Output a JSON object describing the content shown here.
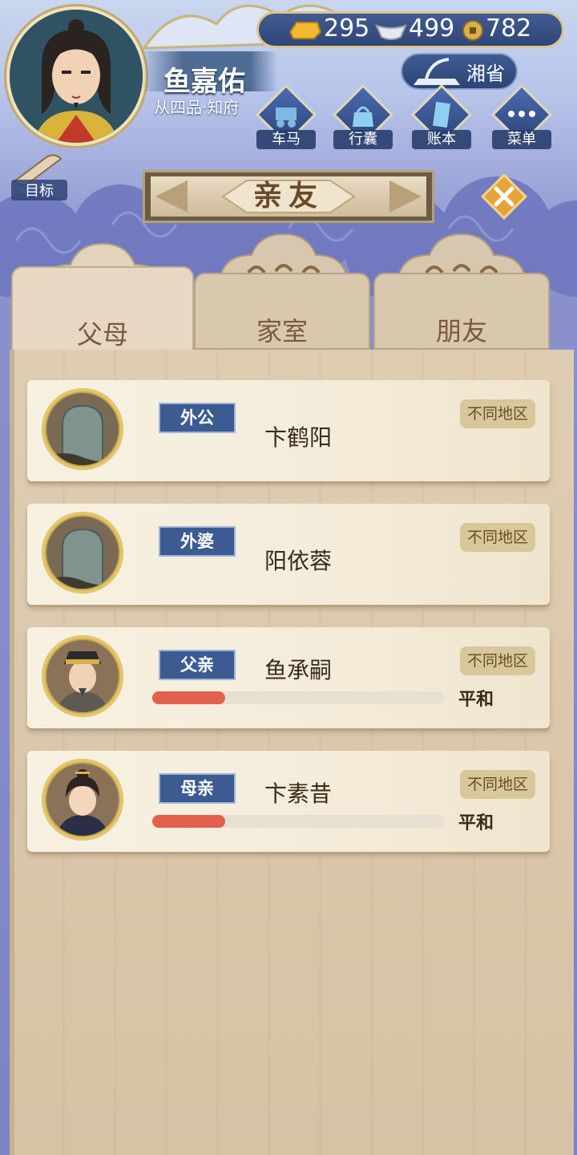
{
  "player": {
    "name": "鱼嘉佑",
    "rank": "从四品·知府"
  },
  "currency": {
    "gold": "295",
    "silver": "499",
    "copper": "782"
  },
  "province": "湘省",
  "menu": {
    "carriage": "车马",
    "bag": "行囊",
    "ledger": "账本",
    "menu": "菜单"
  },
  "goal_label": "目标",
  "title": "亲友",
  "tabs": [
    {
      "label": "父母",
      "active": true
    },
    {
      "label": "家室",
      "active": false
    },
    {
      "label": "朋友",
      "active": false
    }
  ],
  "relatives": [
    {
      "relation": "外公",
      "name": "卞鹤阳",
      "region": "不同地区",
      "deceased": true
    },
    {
      "relation": "外婆",
      "name": "阳依蓉",
      "region": "不同地区",
      "deceased": true
    },
    {
      "relation": "父亲",
      "name": "鱼承嗣",
      "region": "不同地区",
      "deceased": false,
      "relationship_level": 0.25,
      "relationship_status": "平和"
    },
    {
      "relation": "母亲",
      "name": "卞素昔",
      "region": "不同地区",
      "deceased": false,
      "relationship_level": 0.25,
      "relationship_status": "平和"
    }
  ],
  "colors": {
    "badge_blue": "#3b5b92",
    "relationship_bar": "#e2604c",
    "title_brown": "#6a4a2c"
  }
}
